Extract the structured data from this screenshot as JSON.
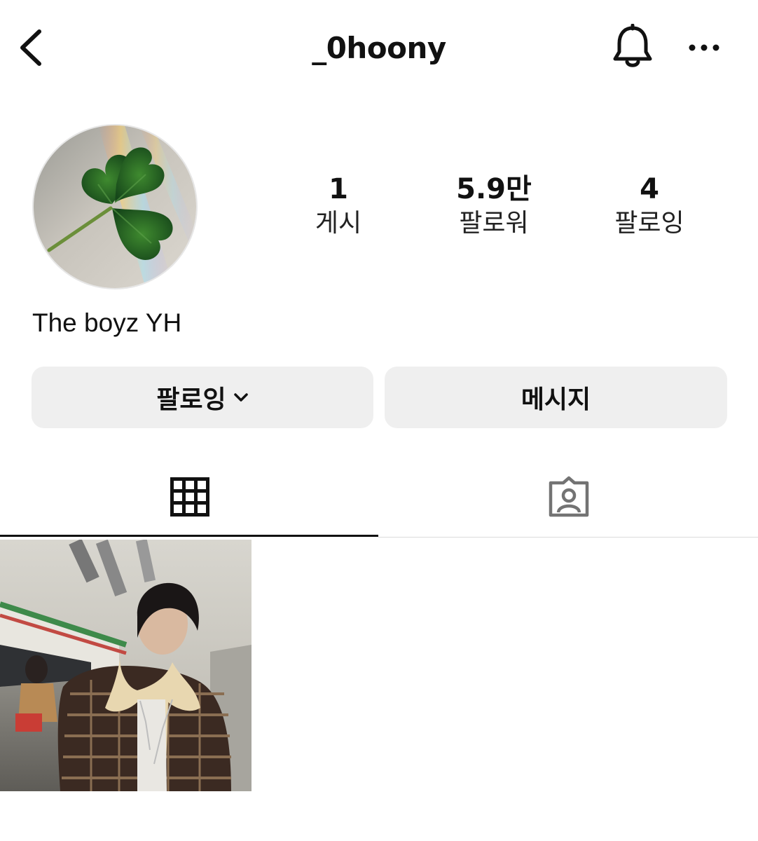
{
  "header": {
    "username": "_0hoony",
    "back_icon": "chevron-left-icon",
    "bell_icon": "bell-icon",
    "more_icon": "more-horizontal-icon"
  },
  "profile": {
    "avatar": "clover-photo",
    "display_name": "The boyz YH",
    "stats": [
      {
        "value": "1",
        "label": "게시"
      },
      {
        "value": "5.9만",
        "label": "팔로워"
      },
      {
        "value": "4",
        "label": "팔로잉"
      }
    ]
  },
  "actions": {
    "following_label": "팔로잉",
    "message_label": "메시지"
  },
  "tabs": {
    "grid_icon": "grid-icon",
    "tagged_icon": "tagged-person-icon",
    "active": "grid"
  },
  "colors": {
    "button_bg": "#efefef",
    "text": "#111111",
    "divider": "#dbdbdb"
  }
}
